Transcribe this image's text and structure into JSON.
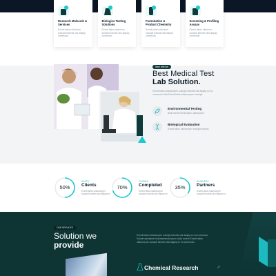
{
  "services": [
    {
      "title": "Research Molecule & Services",
      "desc": "Exenti lation ullamcon suscipit lobortis nisl aliquip commodo"
    },
    {
      "title": "Biologics Testing Solutions",
      "desc": "Exenti lation ullamcon suscipit lobortis nisl aliquip commodo"
    },
    {
      "title": "Formulation & Product Chemistry",
      "desc": "Exenti lation ullamcon suscipit lobortis nisl aliquip commodo"
    },
    {
      "title": "Screening & Profiling Assays",
      "desc": "Exenti lation ullamcon suscipit lobortis nisl aliquip commodo"
    }
  ],
  "about": {
    "pill": "learn with lab",
    "title_line1": "Best Medical Test",
    "title_line2": "Lab Solution.",
    "desc": "Exenti lation ullamcorper suscipit lobortis nisl aliquip ex ea commodo duis Exenti lation ullamcorper suscipit.",
    "features": [
      {
        "title": "Environmental Testing",
        "desc": "Bulk exenti Exenti lation ullamcorper"
      },
      {
        "title": "Biological Evaluation",
        "desc": "Exenti lation ullamcorper suscipit lobortis"
      }
    ]
  },
  "stats": [
    {
      "percent": "50%",
      "value": 0.5,
      "small": "HAPPY",
      "label": "Clients",
      "desc": "Exenti lation ullamcorper suscipit lobortis nisl aliquip ex"
    },
    {
      "percent": "70%",
      "value": 0.7,
      "small": "CLEARS",
      "label": "Completed",
      "desc": "Exenti lation ullamcorper suscipit lobortis nisl aliquip ex"
    },
    {
      "percent": "35%",
      "value": 0.35,
      "small": "BUSINESS",
      "label": "Partners",
      "desc": "Exenti lation ullamcorper suscipit lobortis nisl aliquip ex"
    }
  ],
  "solution": {
    "pill": "OUR SERVICES",
    "title_line1": "Solution we",
    "title_line2": "provide",
    "desc": "Exenti lation ullamcorper suscipit lobortis nisl aliquip ex ea commodo. Solutie dachamet Indorsemenat ipsum dolor autem Exenti lation ullamcorper suscipit lobortis nisl aliquip ex ea commodo.",
    "item_title": "Chemical Research",
    "item_arrow": "↗"
  },
  "colors": {
    "accent": "#1fc9cf",
    "dark_teal": "#0e3434",
    "navy": "#0b1626"
  }
}
